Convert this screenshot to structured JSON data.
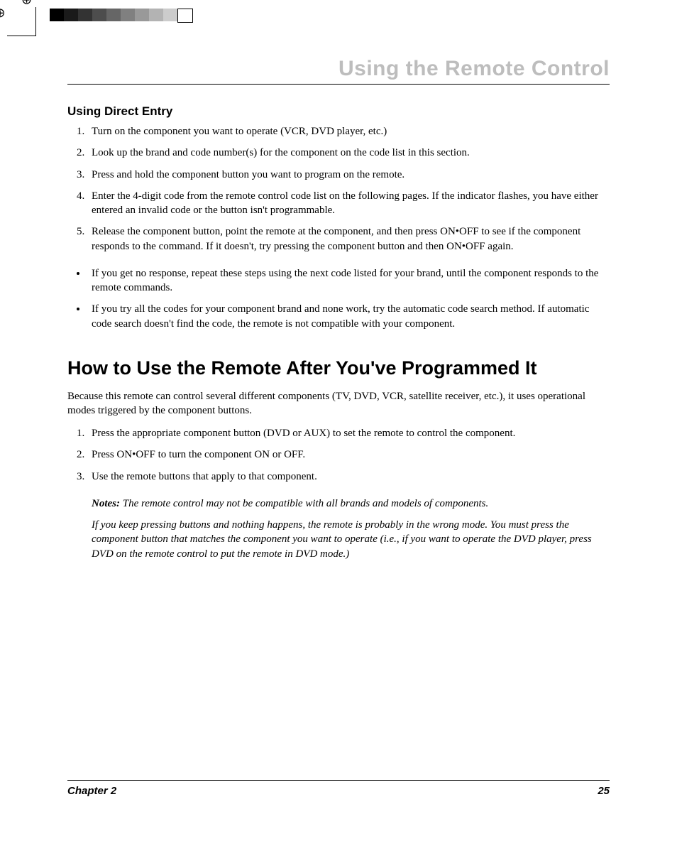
{
  "header": {
    "title": "Using the Remote Control"
  },
  "section1": {
    "heading": "Using Direct Entry",
    "steps": [
      "Turn on the component you want to operate (VCR, DVD player, etc.)",
      "Look up the brand and code number(s) for the component on the code list in this section.",
      "Press and hold the component button you want to program on the remote.",
      "Enter the 4-digit code from the remote control code list on the following pages. If the indicator flashes, you have either entered an invalid code or the button isn't programmable.",
      "Release the component button, point the remote at the component, and then press ON•OFF to see if the component responds to the command. If it doesn't, try pressing the component button and then ON•OFF again."
    ],
    "bullets": [
      "If you get no response, repeat these steps using the next code listed for your brand, until the component responds to the remote commands.",
      "If you try all the codes for your component brand and none work, try the automatic code search method. If automatic code search doesn't find the code, the remote is not compatible with your component."
    ]
  },
  "section2": {
    "heading": "How to Use the Remote After You've Programmed It",
    "intro": "Because this remote can control several different components (TV, DVD, VCR, satellite receiver, etc.), it uses operational modes triggered by the component buttons.",
    "steps": [
      "Press the appropriate component button (DVD or AUX) to set the remote to control the component.",
      "Press ON•OFF to turn the component ON or OFF.",
      "Use the remote buttons that apply to that component."
    ],
    "notes_label": "Notes:",
    "notes": [
      "The remote control may not be compatible with all brands and models of components.",
      "If you keep pressing buttons and nothing happens, the remote is probably in the wrong mode. You must press the component button that matches the component you want to operate (i.e., if you want to operate the DVD player, press DVD on the remote control to put the remote in DVD mode.)"
    ]
  },
  "footer": {
    "chapter": "Chapter 2",
    "page": "25"
  },
  "colorbar_left": [
    "#000000",
    "#1a1a1a",
    "#333333",
    "#4d4d4d",
    "#666666",
    "#808080",
    "#999999",
    "#b3b3b3",
    "#cccccc",
    "#ffffff"
  ],
  "colorbar_right": [
    "#ffff00",
    "#ff00ff",
    "#00a0e3",
    "#00a650",
    "#ed1c24",
    "#000000",
    "#f7c815",
    "#f18dbd",
    "#a0a0a0"
  ]
}
